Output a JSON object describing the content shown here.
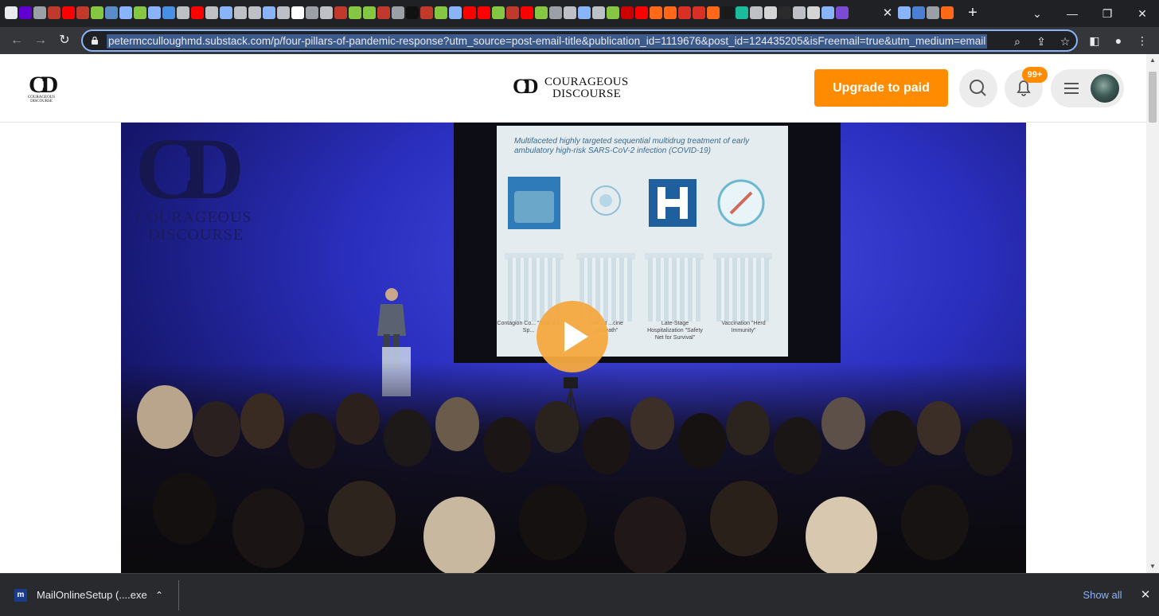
{
  "browser": {
    "url": "petermcculloughmd.substack.com/p/four-pillars-of-pandemic-response?utm_source=post-email-title&publication_id=1119676&post_id=124435205&isFreemail=true&utm_medium=email",
    "tab_favicons": [
      "chrome",
      "yahoo",
      "lit",
      "bi",
      "youtube",
      "bi",
      "rumble",
      "shield",
      "dots",
      "rumble",
      "dots",
      "grid",
      "globe",
      "youtube",
      "globe",
      "dots",
      "globe",
      "globe",
      "search",
      "globe",
      "google",
      "lit",
      "globe",
      "bi",
      "rumble",
      "rumble",
      "bi",
      "lit",
      "dark",
      "bi",
      "rumble",
      "dots",
      "youtube",
      "youtube",
      "rumble",
      "bi",
      "youtube",
      "rumble",
      "lit",
      "globe",
      "search",
      "globe",
      "rumble",
      "cnn",
      "youtube",
      "substack",
      "substack",
      "flag",
      "flag",
      "substack",
      "circle",
      "g",
      "globe",
      "medal",
      "ei",
      "globe",
      "medal",
      "search",
      "email",
      "active"
    ],
    "tab_favicons_after_active": [
      "dots",
      "atom",
      "lit",
      "substack"
    ],
    "colors": {
      "tab_strip": "#202124",
      "toolbar": "#35363a",
      "omnibox_focus": "#8ab4f8"
    }
  },
  "site": {
    "logo_small_text": "COURAGEOUS DISCOURSE",
    "logo_mark": "CD",
    "logo_name_line1": "COURAGEOUS",
    "logo_name_line2": "DISCOURSE",
    "upgrade_label": "Upgrade to paid",
    "notification_badge": "99+",
    "accent_color": "#ff8c00"
  },
  "video": {
    "wall_logo_mark": "CD",
    "wall_text1": "COURAGEOUS",
    "wall_text2": "DISCOURSE",
    "slide_title": "Multifaceted highly targeted sequential multidrug treatment of early ambulatory high-risk SARS-CoV-2 infection (COVID-19)",
    "pillars": [
      {
        "label": "Contagion Co... \"Stop the Sp..."
      },
      {
        "label": "...me ...t ...cine ...n/Death\""
      },
      {
        "label": "Late-Stage Hospitalization \"Safety Net for Survival\""
      },
      {
        "label": "Vaccination \"Herd Immunity\""
      }
    ],
    "play_color": "#f4a940"
  },
  "downloads": {
    "filename": "MailOnlineSetup (....exe",
    "show_all": "Show all"
  }
}
